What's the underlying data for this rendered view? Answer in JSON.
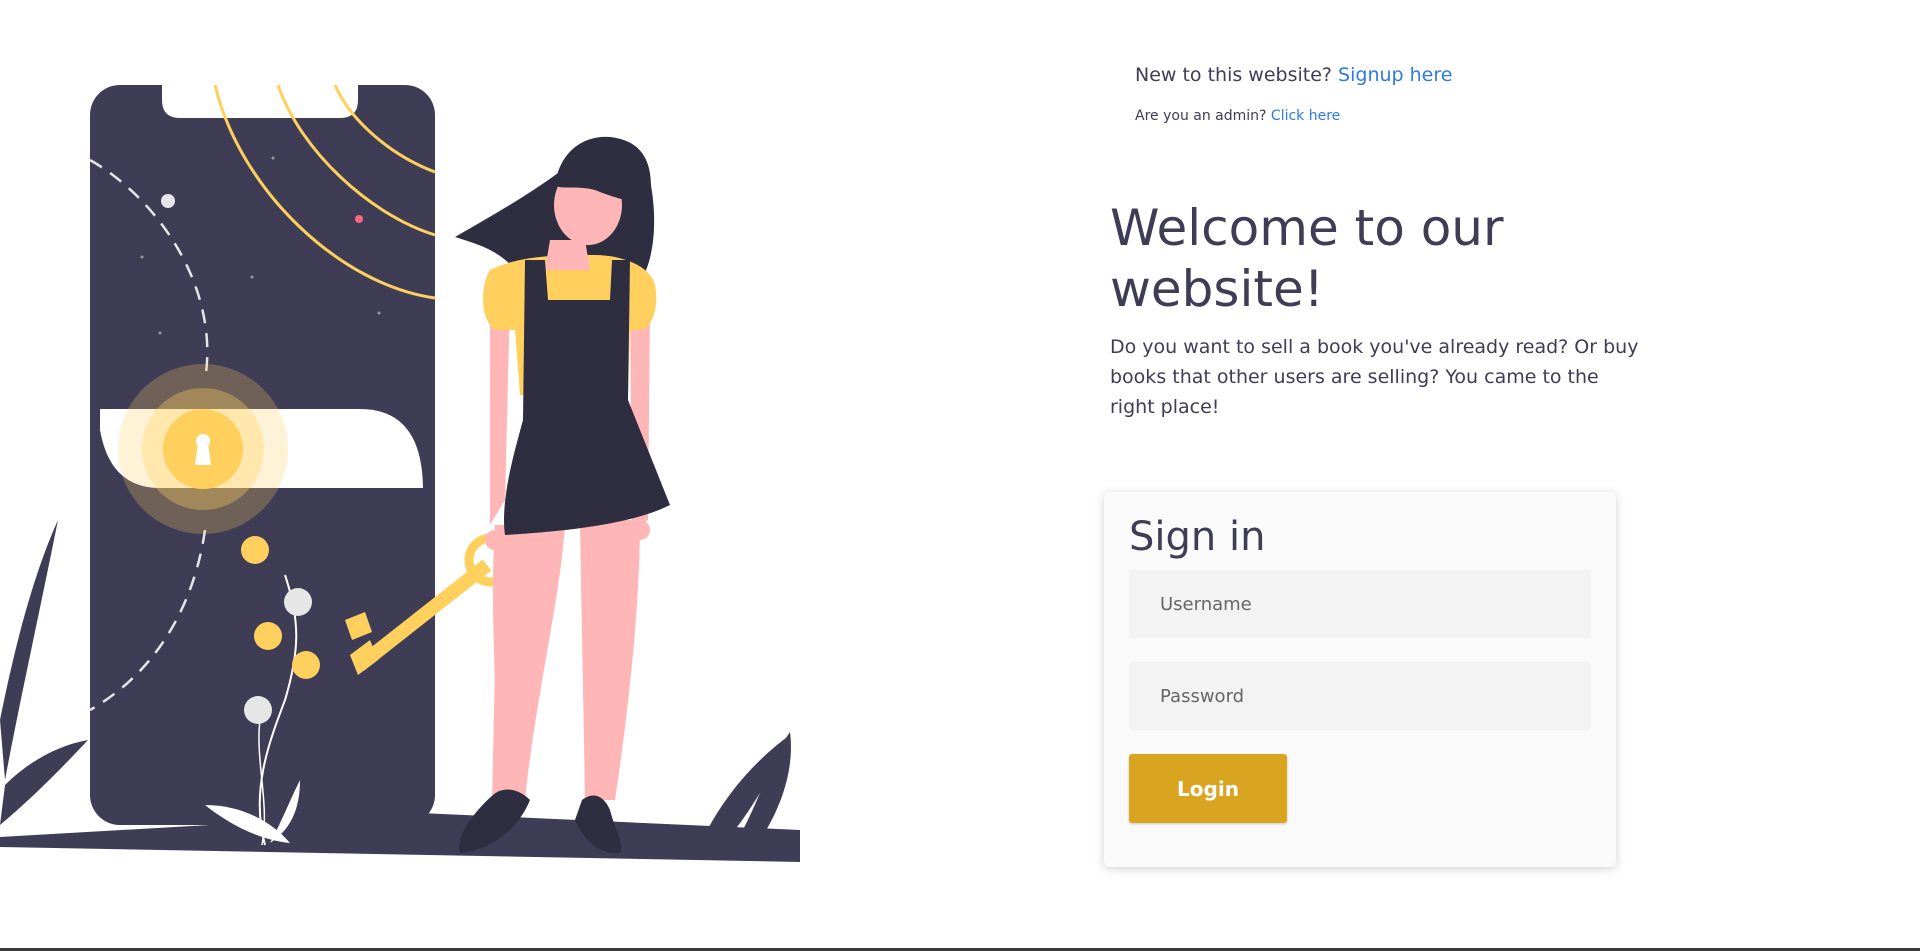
{
  "header": {
    "signup_prompt": "New to this website?",
    "signup_link": "Signup here",
    "admin_prompt": "Are you an admin?",
    "admin_link": "Click here"
  },
  "hero": {
    "title": "Welcome to our website!",
    "description": "Do you want to sell a book you've already read? Or buy books that other users are selling? You came to the right place!"
  },
  "signin": {
    "title": "Sign in",
    "username_placeholder": "Username",
    "password_placeholder": "Password",
    "login_label": "Login"
  },
  "illustration": {
    "icon": "woman-with-key-illustration"
  },
  "colors": {
    "text": "#3f3d56",
    "link": "#2c7be5",
    "button": "#d9a521",
    "accent_yellow": "#ffd05e",
    "skin": "#ffb6b6"
  }
}
